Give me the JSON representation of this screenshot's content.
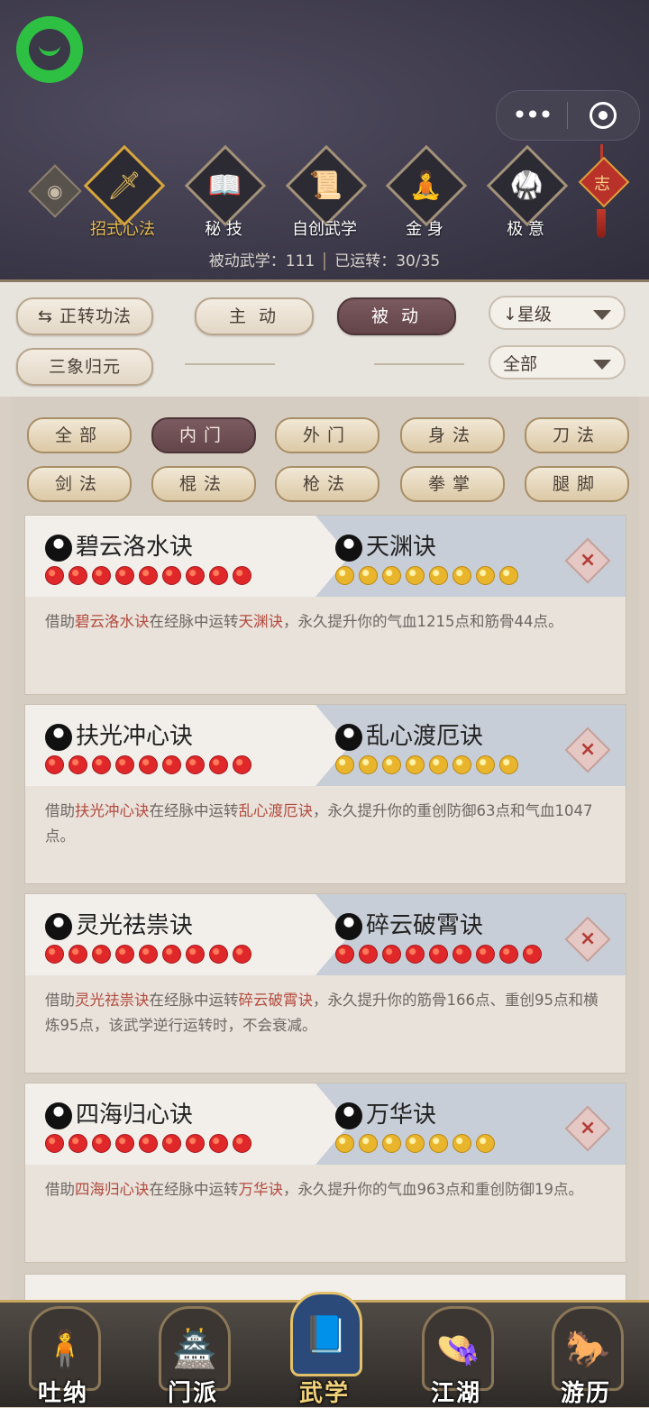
{
  "header": {
    "categories": [
      {
        "label": "招式心法",
        "icon": "sword-icon",
        "glyph": "🗡"
      },
      {
        "label": "秘 技",
        "icon": "book-icon",
        "glyph": "📖"
      },
      {
        "label": "自创武学",
        "icon": "scroll-icon",
        "glyph": "📜"
      },
      {
        "label": "金 身",
        "icon": "meditation-icon",
        "glyph": "🧘"
      },
      {
        "label": "极 意",
        "icon": "martial-stance-icon",
        "glyph": "🥋"
      }
    ],
    "knot_char": "志",
    "stats_passive": "被动武学：111",
    "stats_running": "已运转：30/35"
  },
  "filters": {
    "rotate_button": "⇆ 正转功法",
    "active_tab": "主 动",
    "passive_tab": "被 动",
    "sanxiang_button": "三象归元",
    "sort_dropdown": "↓星级",
    "scope_dropdown": "全部"
  },
  "subcategories": [
    "全部",
    "内门",
    "外门",
    "身法",
    "刀法",
    "剑法",
    "棍法",
    "枪法",
    "拳掌",
    "腿脚"
  ],
  "cards": [
    {
      "left_name": "碧云洛水诀",
      "left_stars": 9,
      "right_name": "天渊诀",
      "right_stars": 8,
      "right_star_color": "gold",
      "desc_prefix": "借助",
      "desc_left": "碧云洛水诀",
      "desc_mid": "在经脉中运转",
      "desc_right": "天渊诀",
      "desc_suffix": "，永久提升你的气血1215点和筋骨44点。"
    },
    {
      "left_name": "扶光冲心诀",
      "left_stars": 9,
      "right_name": "乱心渡厄诀",
      "right_stars": 8,
      "right_star_color": "gold",
      "desc_prefix": "借助",
      "desc_left": "扶光冲心诀",
      "desc_mid": "在经脉中运转",
      "desc_right": "乱心渡厄诀",
      "desc_suffix": "，永久提升你的重创防御63点和气血1047点。"
    },
    {
      "left_name": "灵光祛祟诀",
      "left_stars": 9,
      "right_name": "碎云破霄诀",
      "right_stars": 9,
      "right_star_color": "red",
      "desc_prefix": "借助",
      "desc_left": "灵光祛祟诀",
      "desc_mid": "在经脉中运转",
      "desc_right": "碎云破霄诀",
      "desc_suffix": "，永久提升你的筋骨166点、重创95点和横炼95点，该武学逆行运转时，不会衰减。"
    },
    {
      "left_name": "四海归心诀",
      "left_stars": 9,
      "right_name": "万华诀",
      "right_stars": 7,
      "right_star_color": "gold",
      "desc_prefix": "借助",
      "desc_left": "四海归心诀",
      "desc_mid": "在经脉中运转",
      "desc_right": "万华诀",
      "desc_suffix": "，永久提升你的气血963点和重创防御19点。"
    }
  ],
  "bottom_nav": [
    {
      "label": "吐纳",
      "icon": "monk-icon",
      "glyph": "🧍"
    },
    {
      "label": "门派",
      "icon": "sect-banner-icon",
      "glyph": "🏯"
    },
    {
      "label": "武学",
      "icon": "manual-book-icon",
      "glyph": "📘"
    },
    {
      "label": "江湖",
      "icon": "bamboo-hat-icon",
      "glyph": "👒"
    },
    {
      "label": "游历",
      "icon": "horse-icon",
      "glyph": "🐎"
    }
  ],
  "colors": {
    "highlight": "#b34a3d",
    "active_gold": "#e7be52",
    "selected_chip": "#6e5054"
  }
}
